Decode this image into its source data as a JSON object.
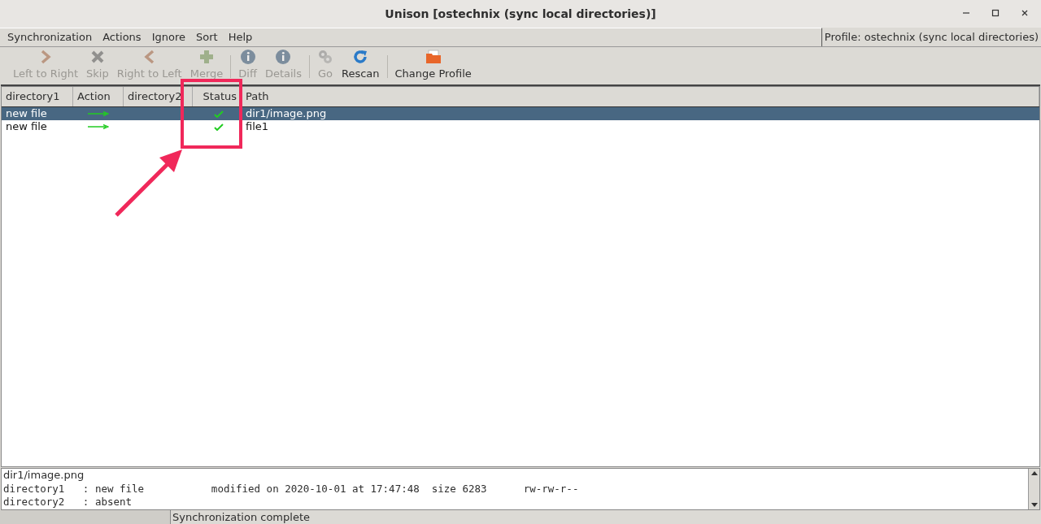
{
  "window": {
    "title": "Unison [ostechnix (sync local directories)]"
  },
  "menu": [
    "Synchronization",
    "Actions",
    "Ignore",
    "Sort",
    "Help"
  ],
  "profile_label": "Profile: ostechnix (sync local directories)",
  "toolbar": [
    {
      "label": "Left to Right",
      "kind": "right",
      "disabled": true
    },
    {
      "label": "Skip",
      "kind": "skip",
      "disabled": true
    },
    {
      "label": "Right to Left",
      "kind": "left",
      "disabled": true
    },
    {
      "label": "Merge",
      "kind": "merge",
      "disabled": true
    },
    {
      "kind": "separator"
    },
    {
      "label": "Diff",
      "kind": "info",
      "disabled": true
    },
    {
      "label": "Details",
      "kind": "info",
      "disabled": true
    },
    {
      "kind": "separator"
    },
    {
      "label": "Go",
      "kind": "go",
      "disabled": true
    },
    {
      "label": "Rescan",
      "kind": "rescan",
      "disabled": false
    },
    {
      "kind": "separator"
    },
    {
      "label": "Change Profile",
      "kind": "profile",
      "disabled": false
    }
  ],
  "table": {
    "columns": [
      "directory1",
      "Action",
      "directory2",
      "Status",
      "Path"
    ],
    "rows": [
      {
        "directory1": "new file",
        "action": {
          "kind": "right"
        },
        "status": {
          "kind": "ok"
        },
        "path": "dir1/image.png",
        "selected": true
      },
      {
        "directory1": "new file",
        "action": {
          "kind": "right"
        },
        "status": {
          "kind": "ok"
        },
        "path": "file1",
        "selected": false
      }
    ]
  },
  "details": [
    "dir1/image.png",
    "directory1   : new file           modified on 2020-10-01 at 17:47:48  size 6283      rw-rw-r--",
    "directory2   : absent"
  ],
  "status_bar": "Synchronization complete"
}
